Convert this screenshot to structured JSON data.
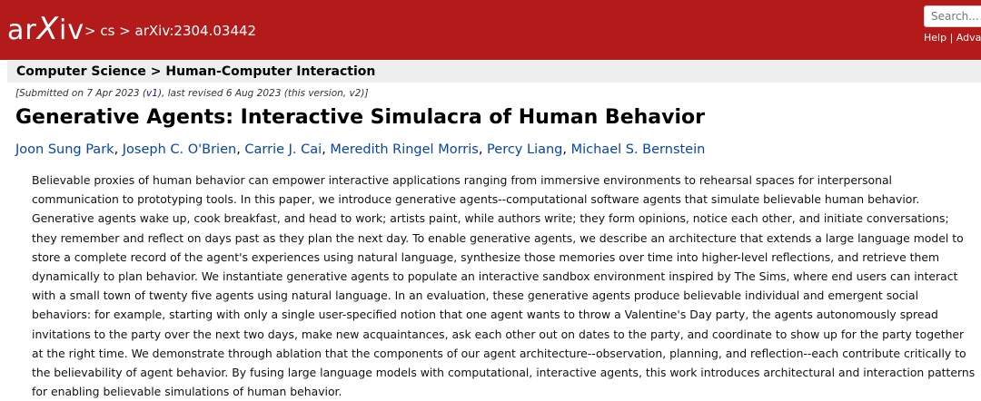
{
  "header": {
    "logo_ar": "ar",
    "logo_x": "X",
    "logo_iv": "iv",
    "breadcrumb_sep1": " > ",
    "breadcrumb_cs": "cs",
    "breadcrumb_sep2": " > ",
    "breadcrumb_id": "arXiv:2304.03442",
    "background_color": "#b31b1b"
  },
  "search": {
    "placeholder": "Search...",
    "help": "Help",
    "divider": " | ",
    "advanced": "Adva"
  },
  "subject": "Computer Science > Human-Computer Interaction",
  "dateline": {
    "prefix": "[Submitted on 7 Apr 2023 (",
    "v1": "v1",
    "suffix": "), last revised 6 Aug 2023 (this version, v2)]"
  },
  "title": "Generative Agents: Interactive Simulacra of Human Behavior",
  "authors": [
    "Joon Sung Park",
    "Joseph C. O'Brien",
    "Carrie J. Cai",
    "Meredith Ringel Morris",
    "Percy Liang",
    "Michael S. Bernstein"
  ],
  "author_separator": ", ",
  "abstract": "Believable proxies of human behavior can empower interactive applications ranging from immersive environments to rehearsal spaces for interpersonal communication to prototyping tools. In this paper, we introduce generative agents--computational software agents that simulate believable human behavior. Generative agents wake up, cook breakfast, and head to work; artists paint, while authors write; they form opinions, notice each other, and initiate conversations; they remember and reflect on days past as they plan the next day. To enable generative agents, we describe an architecture that extends a large language model to store a complete record of the agent's experiences using natural language, synthesize those memories over time into higher-level reflections, and retrieve them dynamically to plan behavior. We instantiate generative agents to populate an interactive sandbox environment inspired by The Sims, where end users can interact with a small town of twenty five agents using natural language. In an evaluation, these generative agents produce believable individual and emergent social behaviors: for example, starting with only a single user-specified notion that one agent wants to throw a Valentine's Day party, the agents autonomously spread invitations to the party over the next two days, make new acquaintances, ask each other out on dates to the party, and coordinate to show up for the party together at the right time. We demonstrate through ablation that the components of our agent architecture--observation, planning, and reflection--each contribute critically to the believability of agent behavior. By fusing large language models with computational, interactive agents, this work introduces architectural and interaction patterns for enabling believable simulations of human behavior."
}
